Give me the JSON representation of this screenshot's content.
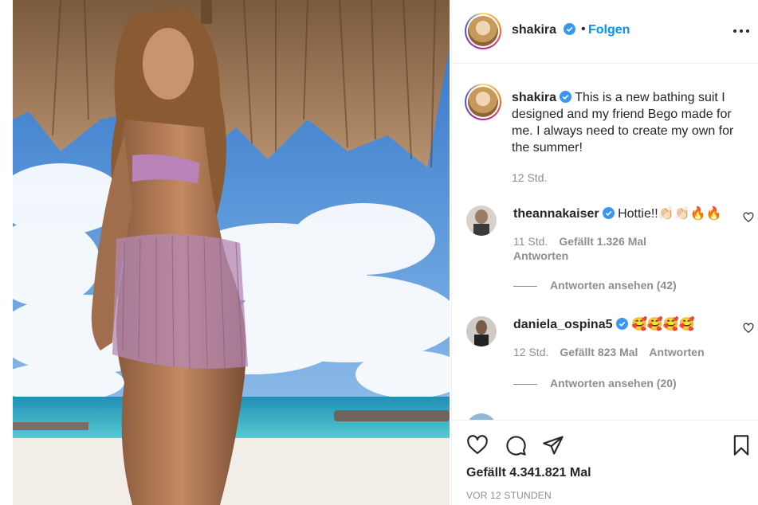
{
  "header": {
    "username": "shakira",
    "follow_label": "Folgen",
    "separator": "•"
  },
  "caption": {
    "username": "shakira",
    "text": "This is a new bathing suit I designed and my friend Bego made for me. I always need to create my own for the summer!",
    "time": "12 Std."
  },
  "comments": [
    {
      "username": "theannakaiser",
      "text": "Hottie!!👏🏻👏🏻🔥🔥",
      "time": "11 Std.",
      "likes": "Gefällt 1.326 Mal",
      "reply_label": "Antworten",
      "view_replies": "Antworten ansehen (42)"
    },
    {
      "username": "daniela_ospina5",
      "text": "🥰🥰🥰🥰",
      "time": "12 Std.",
      "likes": "Gefällt 823 Mal",
      "reply_label": "Antworten",
      "view_replies": "Antworten ansehen (20)"
    }
  ],
  "actions": {
    "likes": "Gefällt 4.341.821 Mal",
    "posted_ago": "VOR 12 STUNDEN"
  },
  "icons": {
    "verified": "verified-badge-icon",
    "more": "more-options-icon",
    "like": "heart-icon",
    "comment": "comment-icon",
    "share": "paper-plane-icon",
    "save": "bookmark-icon"
  },
  "colors": {
    "link": "#0095f6",
    "verified": "#3897f0",
    "text": "#262626",
    "muted": "#8e8e8e",
    "border": "#efefef"
  }
}
